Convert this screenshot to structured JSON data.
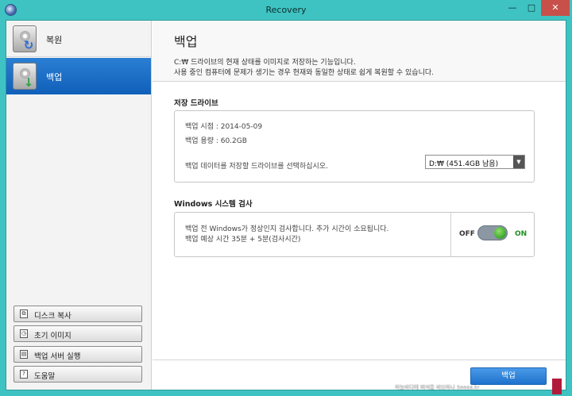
{
  "window": {
    "title": "Recovery",
    "minimize": "—",
    "maximize": "□",
    "close": "✕"
  },
  "sidebar": {
    "nav": [
      {
        "label": "복원",
        "icon": "disk-restore-icon",
        "selected": false
      },
      {
        "label": "백업",
        "icon": "disk-backup-icon",
        "selected": true
      }
    ],
    "buttons": [
      {
        "label": "디스크 복사",
        "icon": "copy-icon"
      },
      {
        "label": "초기 이미지",
        "icon": "image-history-icon"
      },
      {
        "label": "백업 서버 실행",
        "icon": "server-icon"
      },
      {
        "label": "도움말",
        "icon": "help-icon"
      }
    ]
  },
  "header": {
    "title": "백업",
    "desc_line1": "C:₩ 드라이브의 현재 상태를 이미지로 저장하는 기능입니다.",
    "desc_line2": "사용 중인 컴퓨터에 문제가 생기는 경우 현재와 동일한 상태로 쉽게 복원할 수 있습니다."
  },
  "storage": {
    "title": "저장 드라이브",
    "backup_time": "백업 시점 : 2014-05-09",
    "backup_size": "백업 용량 : 60.2GB",
    "select_prompt": "백업 데이터를 저장할 드라이브를 선택하십시오.",
    "drive_value": "D:₩ (451.4GB 남음)"
  },
  "system_check": {
    "title": "Windows 시스템 검사",
    "line1": "백업 전 Windows가 정상인지 검사합니다. 추가 시간이 소요됩니다.",
    "line2": "백업 예상 시간 35분 + 5분(검사시간)",
    "off_label": "OFF",
    "on_label": "ON",
    "toggle_on": true
  },
  "footer": {
    "backup_button": "백업"
  },
  "watermark": {
    "text": "하늘바다에 빠져들 바보하나 Seeaa.kr"
  }
}
